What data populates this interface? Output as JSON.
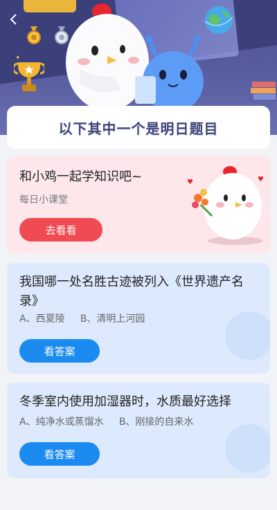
{
  "header": {
    "back_icon": "chevron-left-icon"
  },
  "title": "以下其中一个是明日题目",
  "promo": {
    "heading": "和小鸡一起学知识吧~",
    "subtitle": "每日小课堂",
    "button": "去看看"
  },
  "questions": [
    {
      "text": "我国哪一处名胜古迹被列入《世界遗产名录》",
      "options": "A、西夏陵     B、清明上河园",
      "button": "看答案"
    },
    {
      "text": "冬季室内使用加湿器时，水质最好选择",
      "options": "A、纯净水或蒸馏水     B、刚接的自来水",
      "button": "看答案"
    }
  ],
  "colors": {
    "primary_red": "#f04a52",
    "primary_blue": "#1b8bf0",
    "pink_card": "#fde7ea",
    "blue_card": "#ddeafd"
  }
}
